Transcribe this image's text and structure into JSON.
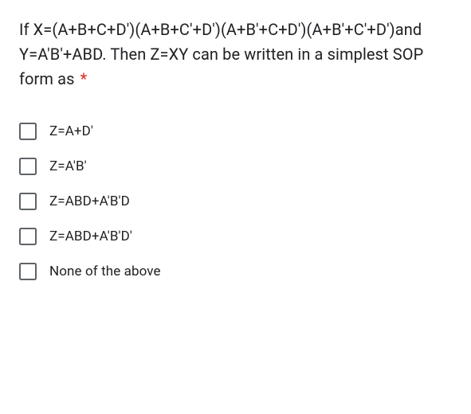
{
  "question": {
    "text": "If X=(A+B+C+D')(A+B+C'+D')(A+B'+C+D')(A+B'+C'+D')and Y=A'B'+ABD. Then Z=XY can be written in a simplest SOP form as",
    "required_mark": "*"
  },
  "options": [
    {
      "label": "Z=A+D'"
    },
    {
      "label": "Z=A'B'"
    },
    {
      "label": "Z=ABD+A'B'D"
    },
    {
      "label": "Z=ABD+A'B'D'"
    },
    {
      "label": "None of the above"
    }
  ]
}
